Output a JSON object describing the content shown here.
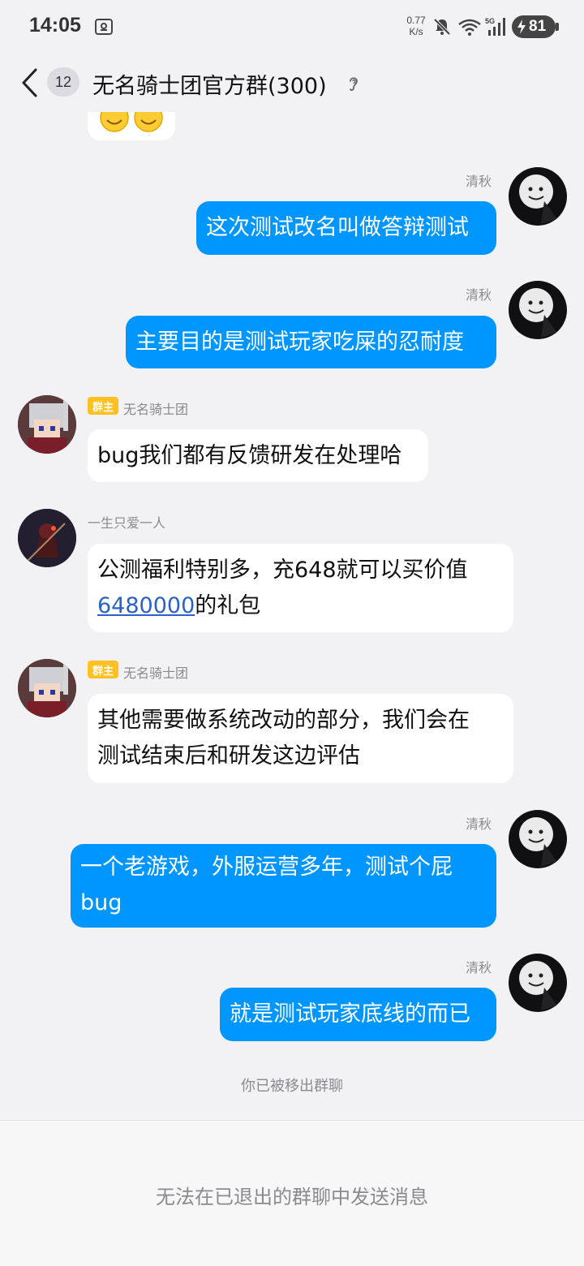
{
  "status_bar": {
    "time": "14:05",
    "net_speed_value": "0.77",
    "net_speed_unit": "K/s",
    "signal_label": "5G",
    "battery": "81"
  },
  "header": {
    "unread_count": "12",
    "title": "无名骑士团官方群(300)"
  },
  "messages": [
    {
      "sender": "清秋",
      "text": "这次测试改名叫做答辩测试",
      "direction": "out"
    },
    {
      "sender": "清秋",
      "text": "主要目的是测试玩家吃屎的忍耐度",
      "direction": "out"
    },
    {
      "sender": "无名骑士团",
      "role": "群主",
      "text": "bug我们都有反馈研发在处理哈",
      "direction": "in"
    },
    {
      "sender": "一生只爱一人",
      "text_line1": "公测福利特别多，充648就可以买价值",
      "text_link": "6480000",
      "text_tail": "的礼包",
      "direction": "in"
    },
    {
      "sender": "无名骑士团",
      "role": "群主",
      "text_line1": "其他需要做系统改动的部分，我们会在",
      "text_line2": "测试结束后和研发这边评估",
      "direction": "in"
    },
    {
      "sender": "清秋",
      "text_line1": "一个老游戏，外服运营多年，测试个屁",
      "text_line2": "bug",
      "direction": "out"
    },
    {
      "sender": "清秋",
      "text": "就是测试玩家底线的而已",
      "direction": "out"
    }
  ],
  "system_notice": "你已被移出群聊",
  "footer": {
    "text": "无法在已退出的群聊中发送消息"
  },
  "colors": {
    "outgoing_bubble": "#0096ff",
    "incoming_bubble": "#ffffff",
    "owner_badge": "#ffc021",
    "background": "#f2f2f4"
  }
}
